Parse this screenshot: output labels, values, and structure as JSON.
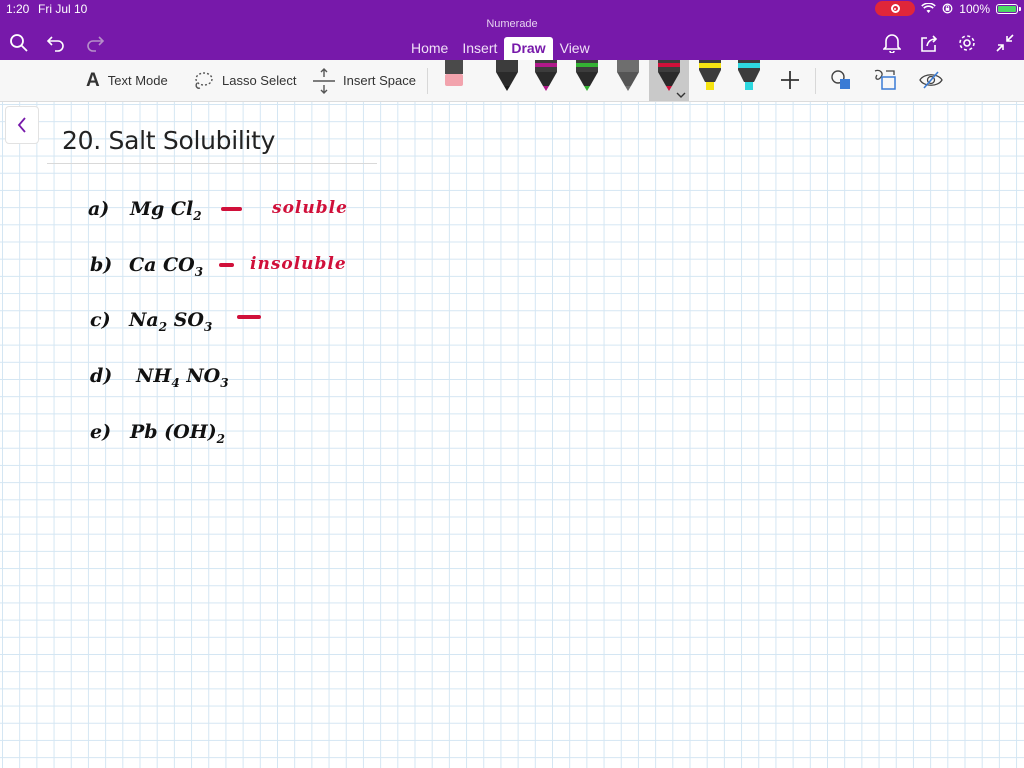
{
  "status_bar": {
    "time": "1:20",
    "date": "Fri Jul 10",
    "battery": "100%"
  },
  "app": {
    "title": "Numerade",
    "tabs": [
      {
        "label": "Home"
      },
      {
        "label": "Insert"
      },
      {
        "label": "Draw",
        "active": true
      },
      {
        "label": "View"
      }
    ]
  },
  "header_icons": {
    "left": [
      "search-icon",
      "undo-icon",
      "redo-icon"
    ],
    "right": [
      "bell-icon",
      "share-icon",
      "gear-icon",
      "collapse-icon"
    ]
  },
  "ribbon": {
    "text_mode": "Text Mode",
    "lasso_select": "Lasso Select",
    "insert_space": "Insert Space",
    "tools": [
      {
        "name": "eraser",
        "color": "#f2a3ad"
      },
      {
        "name": "pen-black",
        "color": "#1a1a1a"
      },
      {
        "name": "pen-magenta",
        "color": "#b0198a"
      },
      {
        "name": "pen-green",
        "color": "#34b233"
      },
      {
        "name": "pen-gray",
        "color": "#6e6e6e"
      },
      {
        "name": "pen-red",
        "color": "#d0103a",
        "selected": true
      },
      {
        "name": "highlighter-yellow",
        "color": "#f6e312"
      },
      {
        "name": "highlighter-cyan",
        "color": "#2ed8e0"
      }
    ]
  },
  "colors": {
    "header_purple": "#7719aa",
    "ink_red": "#d0103a",
    "grid": "#d4e6f3"
  },
  "page": {
    "title": "20. Salt Solubility",
    "items": [
      {
        "label": "a)",
        "formula_main": "Mg Cl",
        "formula_sub": "2",
        "formula_tail": "",
        "answer": "soluble",
        "has_dash": true
      },
      {
        "label": "b)",
        "formula_main": "Ca CO",
        "formula_sub": "3",
        "formula_tail": "",
        "answer": "insoluble",
        "has_dash": true
      },
      {
        "label": "c)",
        "formula_main": "Na",
        "formula_sub": "2",
        "formula_tail": "SO",
        "formula_tail_sub": "3",
        "answer": "",
        "has_dash": true
      },
      {
        "label": "d)",
        "formula_main": "NH",
        "formula_sub": "4",
        "formula_tail": "NO",
        "formula_tail_sub": "3",
        "answer": "",
        "has_dash": false
      },
      {
        "label": "e)",
        "formula_main": "Pb (OH)",
        "formula_sub": "2",
        "formula_tail": "",
        "answer": "",
        "has_dash": false
      }
    ]
  }
}
